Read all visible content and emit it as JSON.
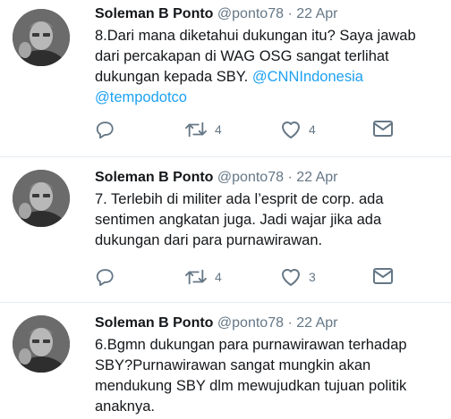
{
  "tweets": [
    {
      "name": "Soleman B Ponto",
      "handle": "@ponto78",
      "separator": "·",
      "date": "22 Apr",
      "text_line1": "8.Dari mana diketahui dukungan itu? Saya jawab",
      "text_line2": "dari percakapan di WAG OSG sangat terlihat",
      "text_line3_pre": "dukungan kepada SBY. ",
      "mention1": "@CNNIndonesia",
      "mention2": "@tempodotco",
      "retweets": "4",
      "likes": "4"
    },
    {
      "name": "Soleman B Ponto",
      "handle": "@ponto78",
      "separator": "·",
      "date": "22 Apr",
      "text_line1": "7. Terlebih di militer ada l’esprit de corp. ada",
      "text_line2": "sentimen angkatan juga. Jadi wajar jika ada",
      "text_line3": "dukungan dari para purnawirawan.",
      "retweets": "4",
      "likes": "3"
    },
    {
      "name": "Soleman B Ponto",
      "handle": "@ponto78",
      "separator": "·",
      "date": "22 Apr",
      "text_line1": "6.Bgmn dukungan para purnawirawan terhadap",
      "text_line2": "SBY?Purnawirawan sangat mungkin akan",
      "text_line3": "mendukung SBY dlm mewujudkan tujuan politik",
      "text_line4": "anaknya."
    }
  ],
  "icons": {
    "reply": "reply-icon",
    "retweet": "retweet-icon",
    "like": "heart-icon",
    "message": "envelope-icon"
  },
  "colors": {
    "link": "#1da1f2",
    "muted": "#657786",
    "text": "#14171a",
    "divider": "#e6ecf0"
  }
}
